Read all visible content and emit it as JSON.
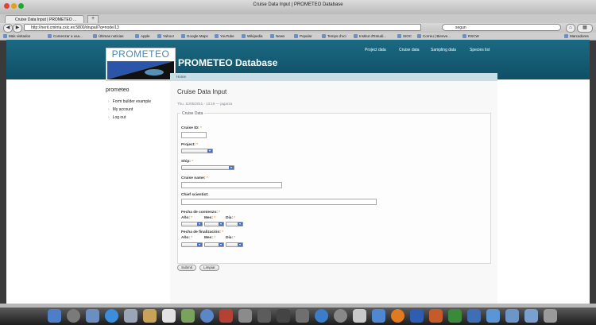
{
  "window": {
    "title": "Cruise Data Input | PROMETEO Database"
  },
  "tabs": [
    {
      "label": "Cruise Data Input | PROMETEO ..."
    }
  ],
  "new_tab_label": "+",
  "nav": {
    "back": "◀",
    "forward": "▶",
    "url": "http://nerit.cmima.csic.es:5800/drupal/?q=node/13",
    "search_value": "segun"
  },
  "bookmarks": [
    "Más visitados",
    "Comenzar a usa...",
    "Últimas noticias",
    "Apple",
    "Yahoo!",
    "Google Maps",
    "YouTube",
    "Wikipedia",
    "News",
    "Popular",
    "Temps d'oci",
    "Institut d'Estudi...",
    "SIOC",
    "Correu | Bienve...",
    "RSCW",
    "Marcadores"
  ],
  "site": {
    "logo_text": "PROMETEO",
    "name": "PROMETEO Database",
    "menu": [
      "Project data",
      "Cruise data",
      "Sampling data",
      "Species list"
    ],
    "breadcrumb": "Home"
  },
  "sidebar": {
    "title": "prometeo",
    "links": [
      "Form builder example",
      "My account",
      "Log out"
    ]
  },
  "main": {
    "title": "Cruise Data Input",
    "meta": "Thu, 11/05/2011 - 13:18 — jagarza",
    "fieldset_legend": "Cruise Data",
    "fields": {
      "cruise_id": "Cruise ID:",
      "project": "Project:",
      "ship": "Ship:",
      "cruise_name": "Cruise name:",
      "chief_scientist": "Chief scientist:",
      "fecha_comienzo": "Fecha de comienzo:",
      "fecha_finalizacion": "Fecha de finalización:",
      "anio": "Año:",
      "mes": "Mes:",
      "dia": "Día:"
    },
    "required_mark": "*",
    "submit_label": "Submit",
    "clear_label": "Limpiar"
  },
  "colors": {
    "header": "#155e76",
    "required": "#e8a33a",
    "select_arrow": "#4a73c4"
  }
}
